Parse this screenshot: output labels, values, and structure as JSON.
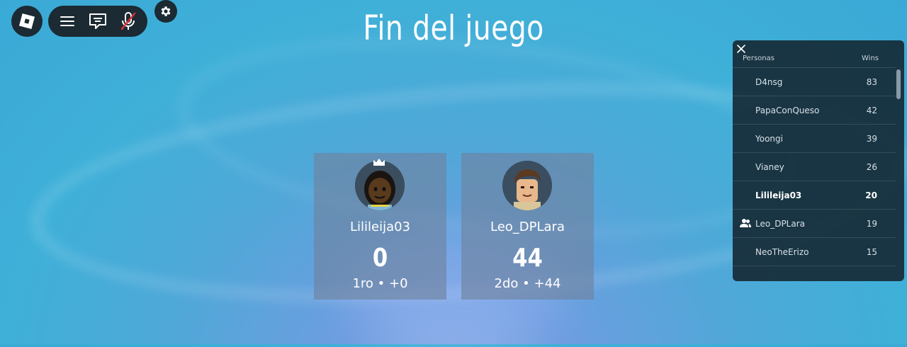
{
  "title": "Fin del juego",
  "toolbar": {
    "menu_icon": "hamburger-menu-icon",
    "chat_icon": "chat-icon",
    "mic_icon": "mic-muted-icon",
    "settings_icon": "gear-icon"
  },
  "players": [
    {
      "name": "Lilileija03",
      "score": "0",
      "rank": "1ro • +0"
    },
    {
      "name": "Leo_DPLara",
      "score": "44",
      "rank": "2do • +44"
    }
  ],
  "leaderboard": {
    "col_name": "Personas",
    "col_wins": "Wins",
    "rows": [
      {
        "name": "D4nsg",
        "wins": "83"
      },
      {
        "name": "PapaConQueso",
        "wins": "42"
      },
      {
        "name": "Yoongi",
        "wins": "39"
      },
      {
        "name": "Vianey",
        "wins": "26"
      },
      {
        "name": "Lilileija03",
        "wins": "20"
      },
      {
        "name": "Leo_DPLara",
        "wins": "19"
      },
      {
        "name": "NeoTheErizo",
        "wins": "15"
      }
    ]
  },
  "colors": {
    "panel": "#1b2a33",
    "background": "#3fb0d8"
  }
}
